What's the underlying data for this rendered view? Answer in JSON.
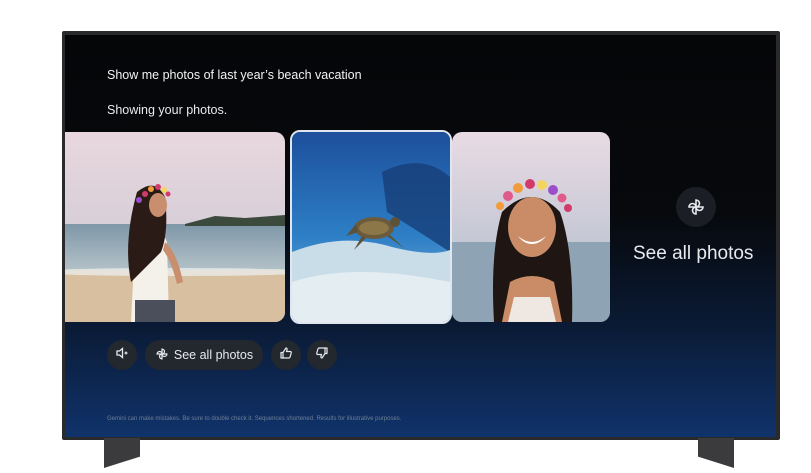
{
  "conversation": {
    "query": "Show me photos of last year’s beach vacation",
    "response": "Showing your photos."
  },
  "photos": [
    {
      "alt": "Woman with flower crown on beach"
    },
    {
      "alt": "Sea turtle underwater"
    },
    {
      "alt": "Smiling woman with flower crown"
    }
  ],
  "see_all_card": {
    "label": "See all photos",
    "icon": "pinwheel-icon"
  },
  "actions": {
    "see_all_label": "See all photos",
    "audio_icon": "speaker-icon",
    "thumbs_up_icon": "thumbs-up-icon",
    "thumbs_down_icon": "thumbs-down-icon"
  },
  "disclaimer": "Gemini can make mistakes. Be sure to double check it. Sequences shortened. Results for illustrative purposes.",
  "colors": {
    "accent_blue": "#10336b",
    "text": "#e8eaed"
  }
}
